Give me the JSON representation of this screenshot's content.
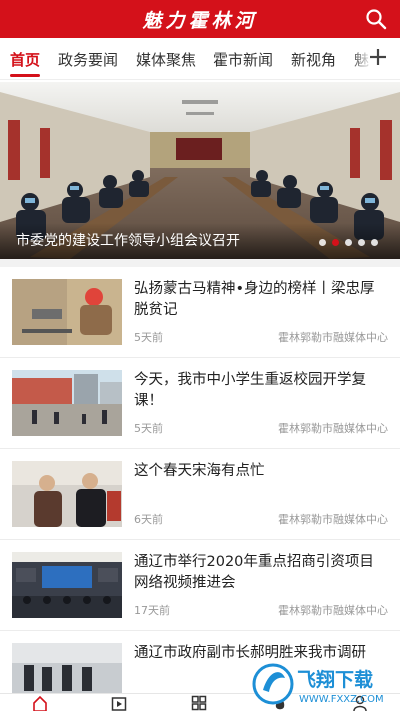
{
  "header": {
    "title": "魅力霍林河",
    "search_icon": "search-icon"
  },
  "tabs": [
    {
      "label": "首页",
      "active": true
    },
    {
      "label": "政务要闻",
      "active": false
    },
    {
      "label": "媒体聚焦",
      "active": false
    },
    {
      "label": "霍市新闻",
      "active": false
    },
    {
      "label": "新视角",
      "active": false
    },
    {
      "label": "魅",
      "active": false
    }
  ],
  "tabs_more_icon": "plus-icon",
  "banner": {
    "caption": "市委党的建设工作领导小组会议召开",
    "dots_total": 5,
    "active_dot": 1
  },
  "news": [
    {
      "title": "弘扬蒙古马精神•身边的榜样丨梁忠厚脱贫记",
      "time": "5天前",
      "source": "霍林郭勒市融媒体中心"
    },
    {
      "title": "今天，我市中小学生重返校园开学复课！",
      "time": "5天前",
      "source": "霍林郭勒市融媒体中心"
    },
    {
      "title": "这个春天宋海有点忙",
      "time": "6天前",
      "source": "霍林郭勒市融媒体中心"
    },
    {
      "title": "通辽市举行2020年重点招商引资项目网络视频推进会",
      "time": "17天前",
      "source": "霍林郭勒市融媒体中心"
    },
    {
      "title": "通辽市政府副市长郝明胜来我市调研",
      "time": "",
      "source": ""
    }
  ],
  "bottom_nav": [
    "home-icon",
    "video-icon",
    "grid-icon",
    "flame-icon",
    "user-icon"
  ],
  "watermark": {
    "brand": "飞翔下载",
    "url": "WWW.FXXZ.COM"
  },
  "colors": {
    "brand_red": "#d4111a",
    "text": "#222222",
    "meta": "#999999"
  }
}
